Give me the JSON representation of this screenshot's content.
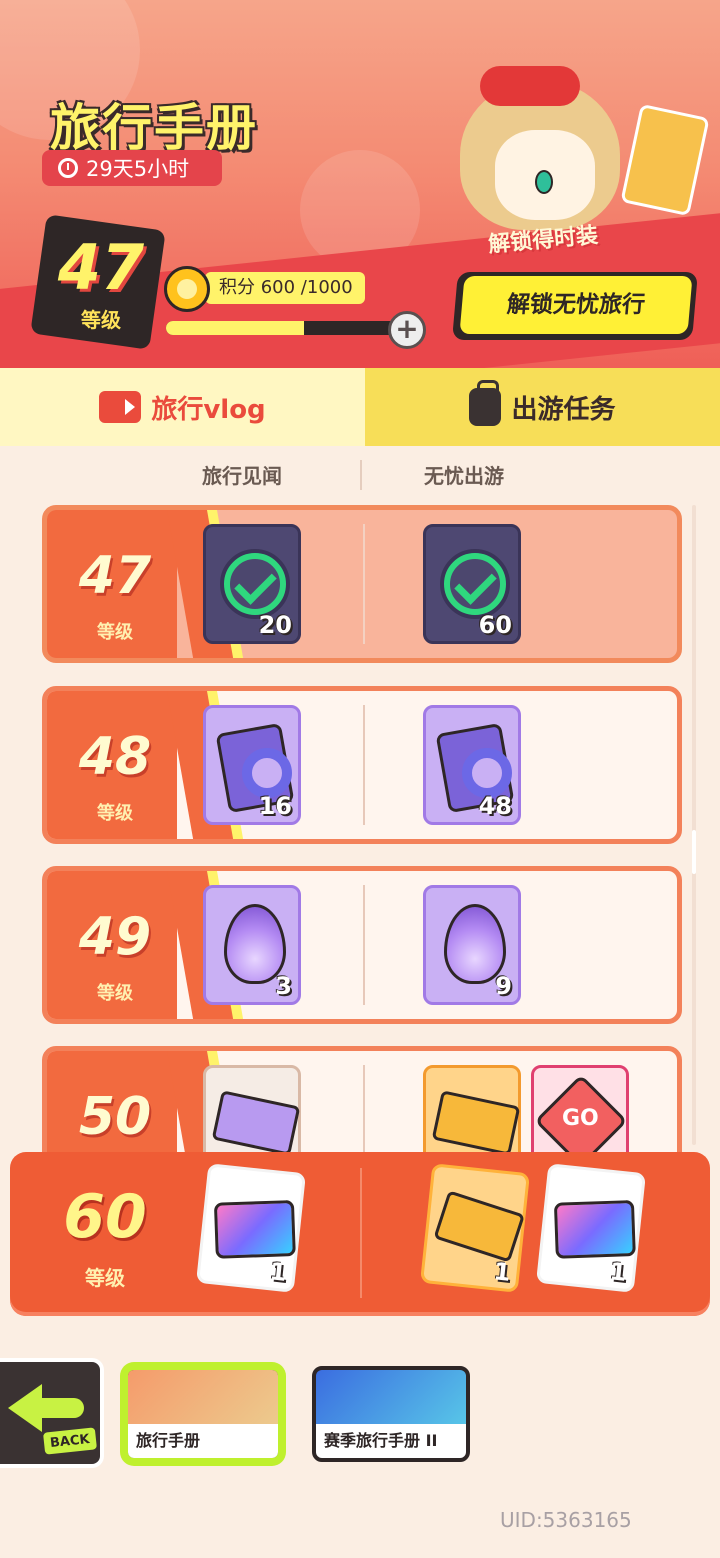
{
  "header": {
    "title": "旅行手册",
    "timer": "29天5小时",
    "level": "47",
    "level_caption": "等级",
    "points_label": "积分 600 /1000",
    "progress": 0.6,
    "unlock_costume": "解锁得时装",
    "unlock_button": "解锁无忧旅行"
  },
  "tabs": [
    {
      "label": "旅行vlog",
      "active": true,
      "icon": "vlog-icon"
    },
    {
      "label": "出游任务",
      "active": false,
      "icon": "bag-icon"
    }
  ],
  "columns": {
    "left": "旅行见闻",
    "right": "无忧出游"
  },
  "rows": [
    {
      "level": "47",
      "caption": "等级",
      "claimed": true,
      "left": [
        {
          "qty": "20",
          "icon": "coin-can-icon",
          "claimed": true
        }
      ],
      "right": [
        {
          "qty": "60",
          "icon": "coin-can-icon",
          "claimed": true
        }
      ]
    },
    {
      "level": "48",
      "caption": "等级",
      "left": [
        {
          "qty": "16",
          "icon": "card-ring-icon"
        }
      ],
      "right": [
        {
          "qty": "48",
          "icon": "card-ring-icon"
        }
      ]
    },
    {
      "level": "49",
      "caption": "等级",
      "left": [
        {
          "qty": "3",
          "icon": "purple-flame-icon"
        }
      ],
      "right": [
        {
          "qty": "9",
          "icon": "purple-flame-icon"
        }
      ]
    },
    {
      "level": "50",
      "caption": "等级",
      "left": [
        {
          "qty": "",
          "icon": "purple-ticket-icon"
        }
      ],
      "right": [
        {
          "qty": "",
          "icon": "gold-ticket-icon"
        },
        {
          "qty": "",
          "icon": "go-dice-icon"
        }
      ]
    }
  ],
  "featured_row": {
    "level": "60",
    "caption": "等级",
    "left": [
      {
        "qty": "1",
        "icon": "rainbow-card-icon"
      }
    ],
    "right": [
      {
        "qty": "1",
        "icon": "gold-ticket-icon"
      },
      {
        "qty": "1",
        "icon": "rainbow-card-icon"
      }
    ]
  },
  "nav": {
    "back_label": "BACK",
    "cards": [
      {
        "label": "旅行手册",
        "active": true
      },
      {
        "label": "赛季旅行手册 II",
        "active": false
      }
    ]
  },
  "uid": "UID:5363165",
  "dice_text": "GO"
}
